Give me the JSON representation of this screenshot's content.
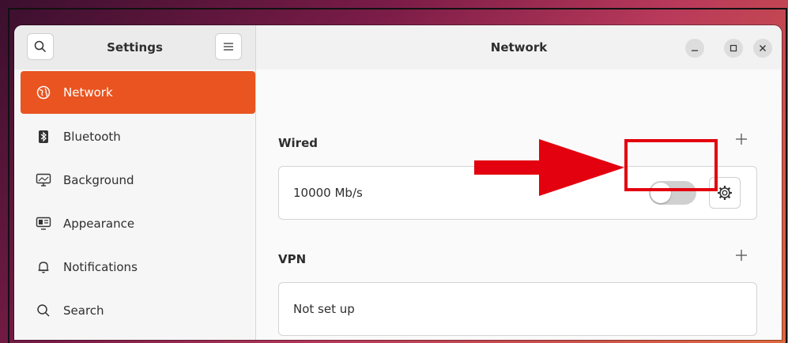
{
  "header": {
    "sidebar_title": "Settings",
    "main_title": "Network",
    "search_icon": "search-icon",
    "menu_icon": "hamburger-menu-icon",
    "window_controls": [
      "minimize",
      "maximize",
      "close"
    ]
  },
  "sidebar": {
    "items": [
      {
        "label": "Network",
        "icon": "globe-icon",
        "active": true
      },
      {
        "label": "Bluetooth",
        "icon": "bluetooth-icon",
        "active": false
      },
      {
        "label": "Background",
        "icon": "monitor-icon",
        "active": false
      },
      {
        "label": "Appearance",
        "icon": "appearance-icon",
        "active": false
      },
      {
        "label": "Notifications",
        "icon": "bell-icon",
        "active": false
      },
      {
        "label": "Search",
        "icon": "search-icon",
        "active": false
      }
    ]
  },
  "network": {
    "wired": {
      "section_label": "Wired",
      "connection_label": "10000 Mb/s",
      "toggle_on": false
    },
    "vpn": {
      "section_label": "VPN",
      "status": "Not set up"
    }
  },
  "colors": {
    "accent": "#e95420",
    "annotation": "#e3000f"
  }
}
